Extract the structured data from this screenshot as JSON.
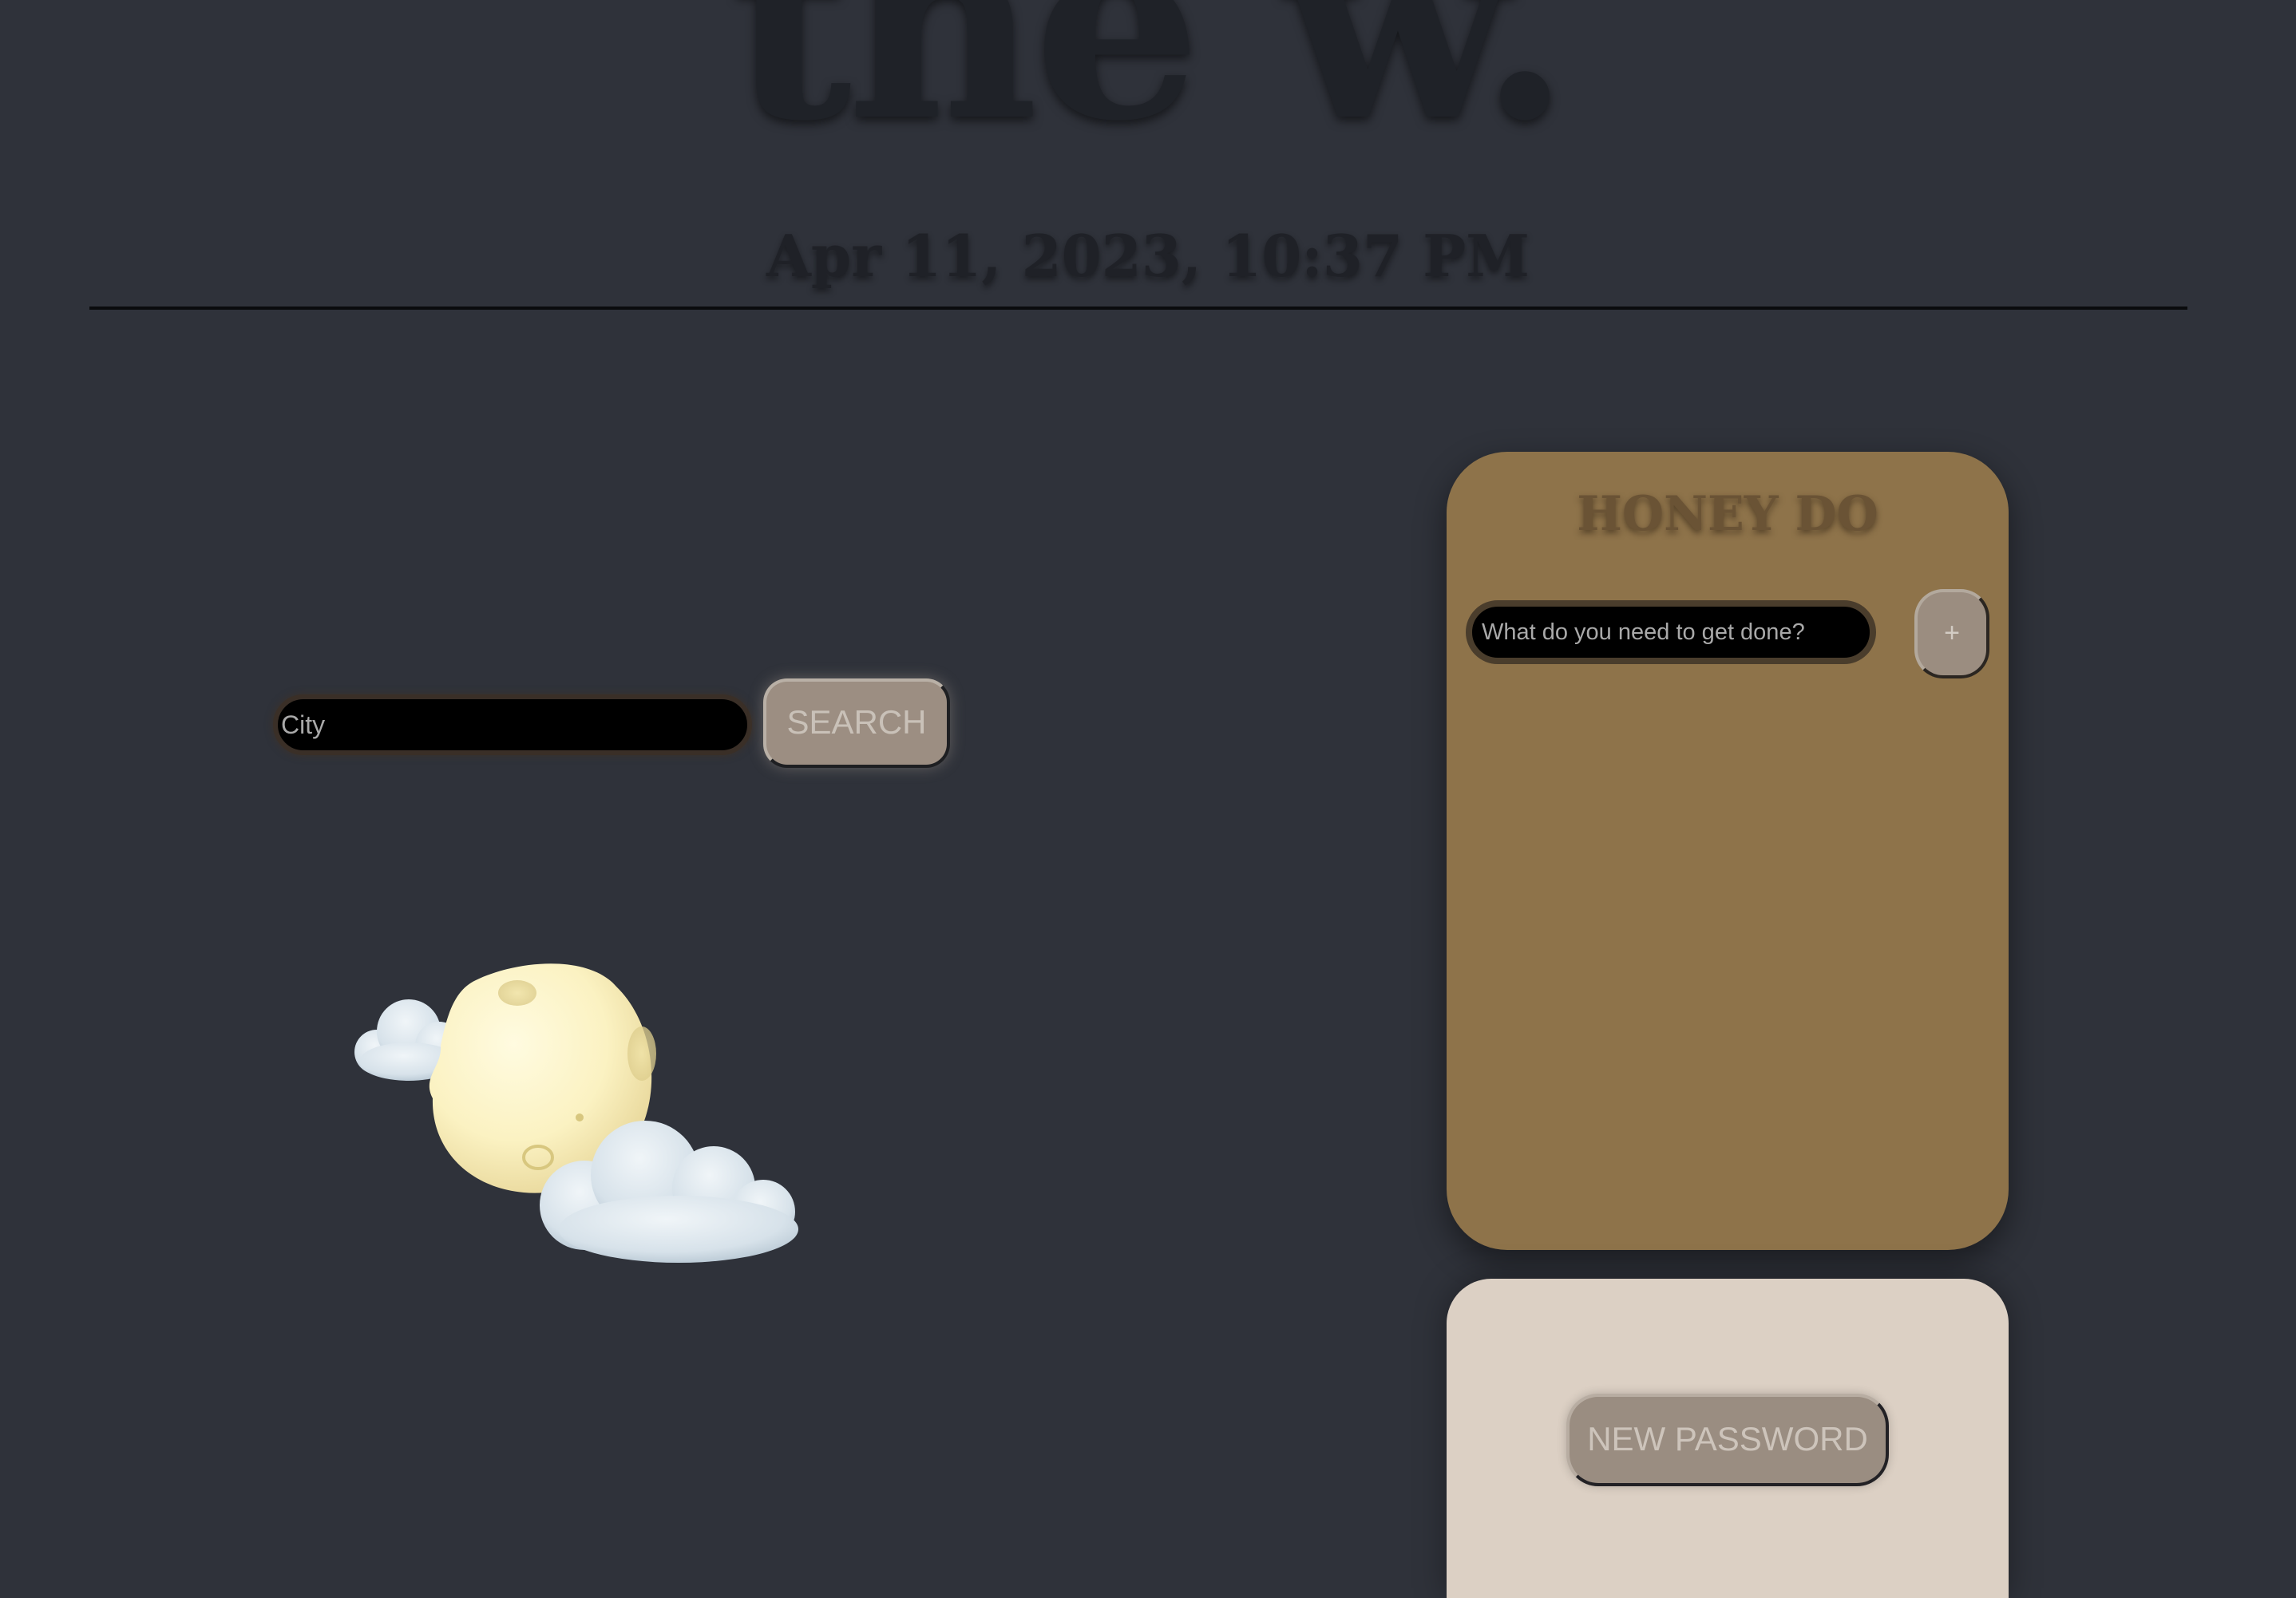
{
  "header": {
    "site_title": "the w.",
    "datetime": "Apr 11, 2023, 10:37 PM"
  },
  "weather": {
    "search": {
      "placeholder": "City",
      "button_label": "SEARCH"
    },
    "icon": "moon-with-clouds-icon"
  },
  "todo": {
    "title": "HONEY DO",
    "input_placeholder": "What do you need to get done?",
    "add_label": "+",
    "items": []
  },
  "password": {
    "button_label": "NEW PASSWORD"
  },
  "colors": {
    "background": "#2f323a",
    "todo_card": "#8e734a",
    "password_card": "#dcd0c4",
    "button": "#9c8e82",
    "moon": "#fff6c8",
    "cloud": "#dbe6ee"
  }
}
